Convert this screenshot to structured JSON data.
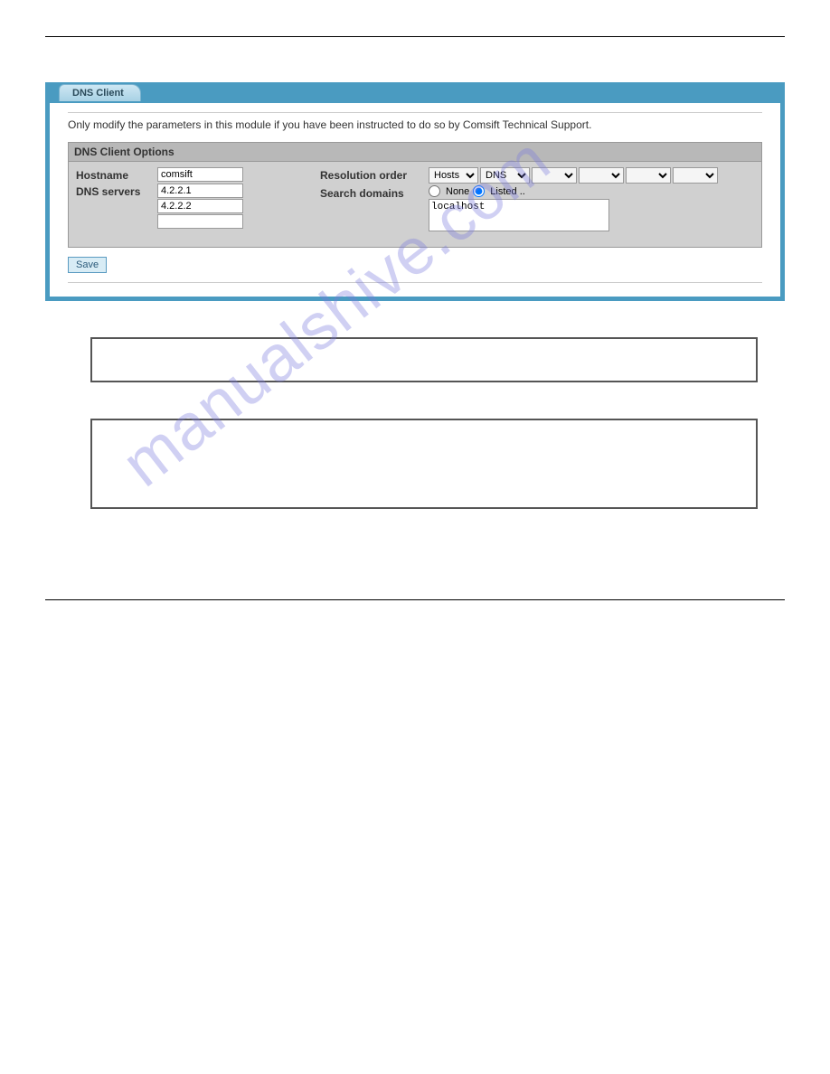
{
  "module": {
    "tab_label": "DNS Client",
    "caution_text": "Only modify the parameters in this module if you have been instructed to do so by Comsift Technical Support.",
    "panel_title": "DNS Client Options",
    "hostname_label": "Hostname",
    "hostname_value": "comsift",
    "dns_servers_label": "DNS servers",
    "dns_servers": [
      "4.2.2.1",
      "4.2.2.2",
      ""
    ],
    "resolution_order_label": "Resolution order",
    "resolution_order": [
      "Hosts",
      "DNS",
      "",
      "",
      "",
      ""
    ],
    "search_domains_label": "Search domains",
    "radio_none": "None",
    "radio_listed": "Listed ..",
    "search_domains_text": "localhost",
    "save_label": "Save"
  },
  "watermark": "manualshive.com"
}
